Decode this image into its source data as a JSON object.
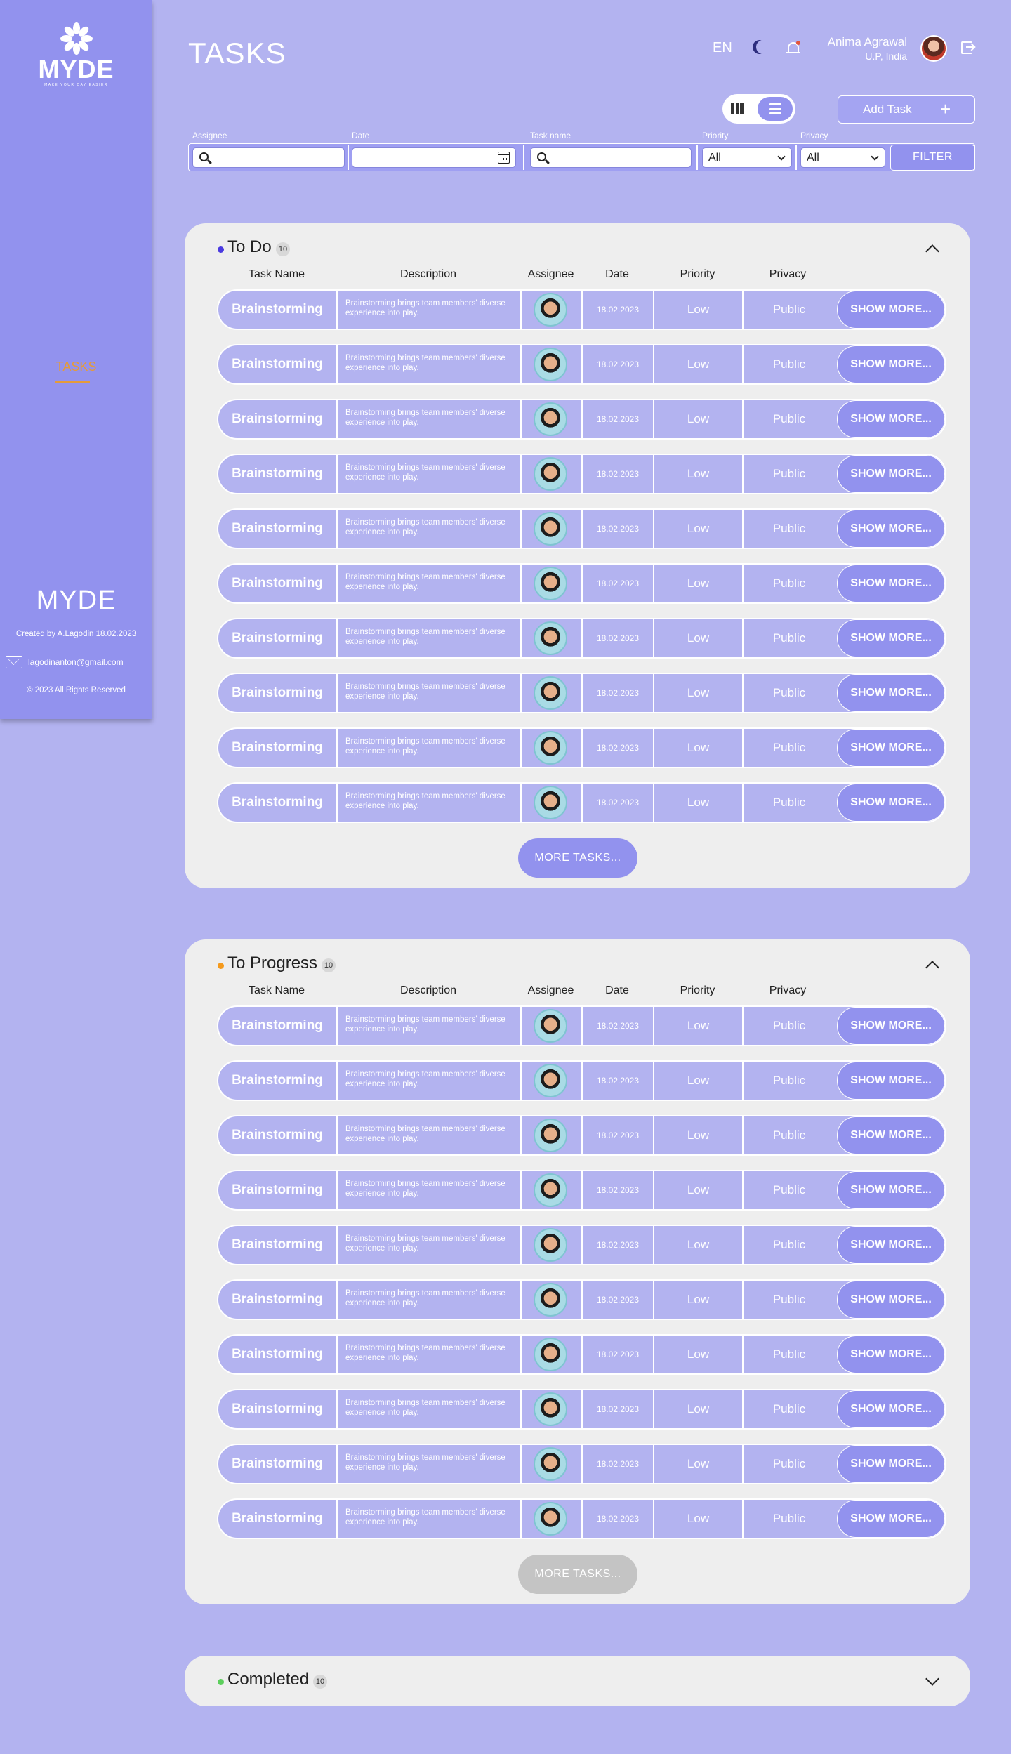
{
  "brand": {
    "logo": "MYDE",
    "tagline": "MAKE YOUR DAY EASIER"
  },
  "nav": {
    "tasks": "TASKS"
  },
  "footer": {
    "logo": "MYDE",
    "created": "Created by A.Lagodin 18.02.2023",
    "email": "lagodinanton@gmail.com",
    "copyright": "© 2023 All Rights Reserved"
  },
  "header": {
    "title": "TASKS",
    "language": "EN",
    "user_name": "Anima Agrawal",
    "user_location": "U.P, India"
  },
  "actions": {
    "add_task": "Add Task",
    "add_icon": "+"
  },
  "filters": {
    "assignee_label": "Assignee",
    "date_label": "Date",
    "task_name_label": "Task name",
    "priority_label": "Priority",
    "privacy_label": "Privacy",
    "priority_value": "All",
    "privacy_value": "All",
    "filter_button": "FILTER"
  },
  "columns": [
    "Task Name",
    "Description",
    "Assignee",
    "Date",
    "Priority",
    "Privacy"
  ],
  "sections": [
    {
      "title": "To Do",
      "count": "10",
      "dot_color": "#4a3ae0",
      "expanded": true,
      "more_label": "MORE TASKS...",
      "more_color": "#9292ee"
    },
    {
      "title": "To Progress",
      "count": "10",
      "dot_color": "#f59a1c",
      "expanded": true,
      "more_label": "MORE TASKS...",
      "more_color": "#c4c4c4"
    },
    {
      "title": "Completed",
      "count": "10",
      "dot_color": "#5ccf5c",
      "expanded": false
    }
  ],
  "task_row": {
    "name": "Brainstorming",
    "description": "Brainstorming brings team members' diverse experience into play.",
    "date": "18.02.2023",
    "priority": "Low",
    "privacy": "Public",
    "show_more": "SHOW MORE..."
  },
  "colors": {
    "background": "#b3b3f0",
    "sidebar": "#9292ee",
    "accent": "#e49b3a",
    "card": "#eeeeee"
  }
}
